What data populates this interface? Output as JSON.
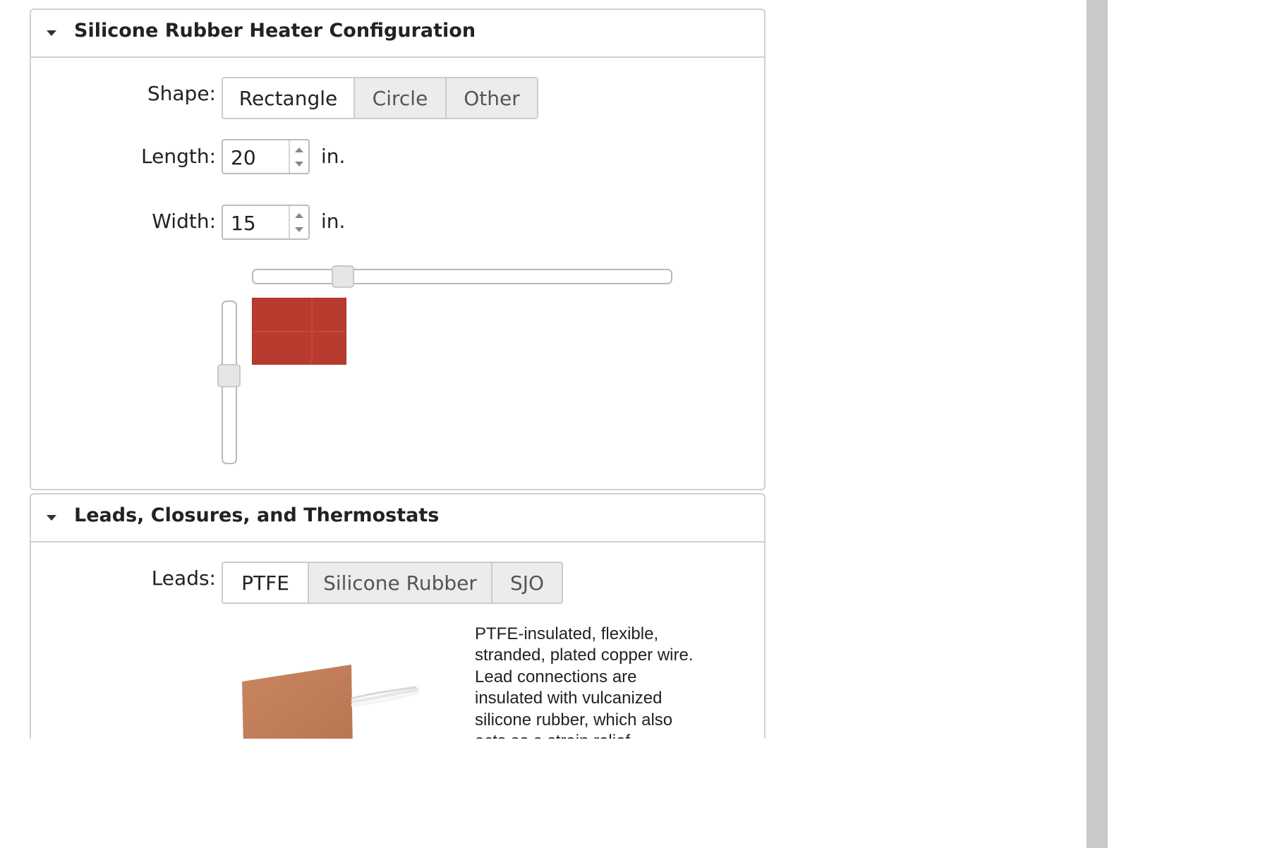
{
  "config_panel": {
    "title": "Silicone Rubber Heater Configuration",
    "shape": {
      "label": "Shape:",
      "options": [
        "Rectangle",
        "Circle",
        "Other"
      ],
      "selected": "Rectangle"
    },
    "length": {
      "label": "Length:",
      "value": "20",
      "unit": "in."
    },
    "width": {
      "label": "Width:",
      "value": "15",
      "unit": "in."
    },
    "length_slider_fraction": 0.2,
    "width_slider_fraction": 0.45,
    "preview_color": "#b83b30"
  },
  "leads_panel": {
    "title": "Leads, Closures, and Thermostats",
    "leads": {
      "label": "Leads:",
      "options": [
        "PTFE",
        "Silicone Rubber",
        "SJO"
      ],
      "selected": "PTFE"
    },
    "description": "PTFE-insulated, flexible, stranded, plated copper wire. Lead connections are insulated with vulcanized silicone rubber, which also acts as a strain relief."
  }
}
